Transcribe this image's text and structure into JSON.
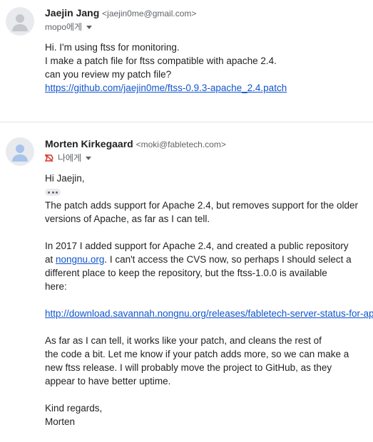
{
  "messages": [
    {
      "sender_name": "Jaejin Jang",
      "sender_email": "<jaejin0me@gmail.com>",
      "to_label": "mopo에게",
      "lines": [
        "Hi. I'm using ftss for monitoring.",
        "I make a patch file for ftss compatible with apache 2.4.",
        "can you review my patch file?"
      ],
      "link": "https://github.com/jaejin0me/ftss-0.9.3-apache_2.4.patch"
    },
    {
      "sender_name": "Morten Kirkegaard",
      "sender_email": "<moki@fabletech.com>",
      "to_label": "나에게",
      "greeting": "Hi Jaejin,",
      "para1": [
        "The patch adds support for Apache 2.4, but removes support for the older",
        "versions of Apache, as far as I can tell."
      ],
      "para2_line1": "In 2017 I added support for Apache 2.4, and created a public repository",
      "para2_at": "at ",
      "para2_link": "nongnu.org",
      "para2_line2_rest": ".  I can't access the CVS now, so perhaps I should select a",
      "para2_line3": "different place to keep the repository, but the ftss-1.0.0 is available",
      "para2_line4": "here:",
      "download_link": "http://download.savannah.nongnu.org/releases/fabletech-server-status-for-ap/",
      "para3": [
        "As far as I can tell, it works like your patch, and cleans the rest of",
        "the code a bit.  Let me know if your patch adds more, so we can make a",
        "new ftss release.  I will probably move the project to GitHub, as they",
        "appear to have better uptime."
      ],
      "closing": "Kind regards,",
      "signature": "Morten"
    }
  ],
  "icons": {
    "avatar": "person-icon",
    "expand": "caret-down-icon",
    "importance": "important-not-icon",
    "trimmed": "ellipsis-icon"
  },
  "colors": {
    "link": "#1155cc",
    "secondary_text": "#5f6368",
    "importance_red": "#d93025"
  }
}
